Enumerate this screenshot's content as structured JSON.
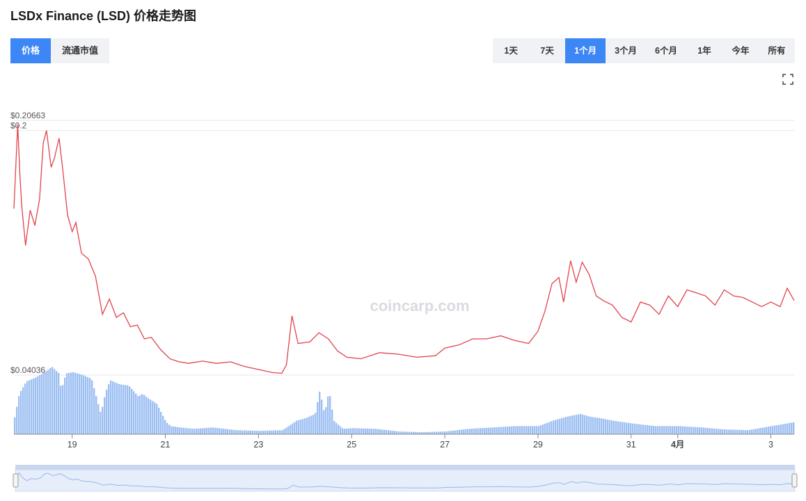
{
  "header": {
    "title": "LSDx Finance (LSD) 价格走势图"
  },
  "metric_tabs": [
    {
      "label": "价格",
      "active": true
    },
    {
      "label": "流通市值",
      "active": false
    }
  ],
  "ranges": [
    {
      "label": "1天",
      "active": false
    },
    {
      "label": "7天",
      "active": false
    },
    {
      "label": "1个月",
      "active": true
    },
    {
      "label": "3个月",
      "active": false
    },
    {
      "label": "6个月",
      "active": false
    },
    {
      "label": "1年",
      "active": false
    },
    {
      "label": "今年",
      "active": false
    },
    {
      "label": "所有",
      "active": false
    }
  ],
  "watermark": "coincarp.com",
  "colors": {
    "line": "#e0424b",
    "volume": "#9dbff2",
    "accent": "#3d86f5",
    "navigator_fill": "#dde8fb"
  },
  "chart_data": {
    "type": "line",
    "title": "",
    "xlabel": "",
    "ylabel": "",
    "y_labels": [
      "$0.20663",
      "$0.2",
      "$0.04036"
    ],
    "ylim": [
      0.04036,
      0.20663
    ],
    "x_ticks": [
      {
        "label": "19",
        "day": 19
      },
      {
        "label": "21",
        "day": 21
      },
      {
        "label": "23",
        "day": 23
      },
      {
        "label": "25",
        "day": 25
      },
      {
        "label": "27",
        "day": 27
      },
      {
        "label": "29",
        "day": 29
      },
      {
        "label": "31",
        "day": 31
      },
      {
        "label": "4月",
        "day": 32
      },
      {
        "label": "3",
        "day": 34
      }
    ],
    "xlim": [
      17.75,
      34.5
    ],
    "price_series": {
      "x": [
        17.75,
        17.83,
        17.88,
        17.92,
        18.0,
        18.1,
        18.2,
        18.3,
        18.38,
        18.45,
        18.55,
        18.62,
        18.72,
        18.8,
        18.9,
        19.0,
        19.08,
        19.2,
        19.35,
        19.5,
        19.65,
        19.8,
        19.95,
        20.1,
        20.25,
        20.4,
        20.55,
        20.7,
        20.9,
        21.1,
        21.3,
        21.5,
        21.8,
        22.1,
        22.4,
        22.7,
        23.0,
        23.3,
        23.5,
        23.6,
        23.72,
        23.85,
        24.1,
        24.3,
        24.5,
        24.7,
        24.9,
        25.2,
        25.6,
        26.0,
        26.4,
        26.8,
        27.0,
        27.3,
        27.6,
        27.9,
        28.2,
        28.5,
        28.8,
        29.0,
        29.15,
        29.3,
        29.45,
        29.55,
        29.7,
        29.82,
        29.95,
        30.1,
        30.25,
        30.4,
        30.6,
        30.8,
        31.0,
        31.2,
        31.4,
        31.6,
        31.8,
        32.0,
        32.2,
        32.4,
        32.6,
        32.8,
        33.0,
        33.2,
        33.4,
        33.6,
        33.8,
        34.0,
        34.2,
        34.35,
        34.5
      ],
      "y": [
        0.149,
        0.204,
        0.17,
        0.15,
        0.125,
        0.148,
        0.138,
        0.155,
        0.192,
        0.2,
        0.176,
        0.182,
        0.195,
        0.174,
        0.145,
        0.134,
        0.14,
        0.12,
        0.116,
        0.105,
        0.08,
        0.09,
        0.078,
        0.081,
        0.072,
        0.073,
        0.064,
        0.065,
        0.057,
        0.051,
        0.049,
        0.048,
        0.0495,
        0.048,
        0.049,
        0.046,
        0.044,
        0.042,
        0.0415,
        0.047,
        0.079,
        0.061,
        0.062,
        0.068,
        0.064,
        0.056,
        0.052,
        0.051,
        0.055,
        0.054,
        0.052,
        0.053,
        0.058,
        0.06,
        0.064,
        0.064,
        0.066,
        0.063,
        0.061,
        0.069,
        0.082,
        0.1,
        0.104,
        0.088,
        0.115,
        0.101,
        0.114,
        0.106,
        0.092,
        0.089,
        0.086,
        0.078,
        0.075,
        0.088,
        0.086,
        0.08,
        0.092,
        0.085,
        0.096,
        0.094,
        0.092,
        0.086,
        0.096,
        0.092,
        0.091,
        0.088,
        0.085,
        0.088,
        0.085,
        0.097,
        0.089
      ]
    },
    "volume_series": {
      "x": [
        17.75,
        17.85,
        18.0,
        18.2,
        18.4,
        18.55,
        18.7,
        18.75,
        18.85,
        19.0,
        19.2,
        19.4,
        19.6,
        19.7,
        19.8,
        20.0,
        20.2,
        20.4,
        20.5,
        20.6,
        20.8,
        21.0,
        21.1,
        21.3,
        21.6,
        22.0,
        22.5,
        23.0,
        23.5,
        23.8,
        24.0,
        24.2,
        24.3,
        24.4,
        24.5,
        24.6,
        24.8,
        25.0,
        25.5,
        26.0,
        26.5,
        27.0,
        27.5,
        28.0,
        28.5,
        29.0,
        29.3,
        29.6,
        29.9,
        30.1,
        30.3,
        30.6,
        31.0,
        31.5,
        32.0,
        32.5,
        33.0,
        33.5,
        34.0,
        34.5
      ],
      "y": [
        0.25,
        0.6,
        0.78,
        0.84,
        0.92,
        1.0,
        0.9,
        0.65,
        0.9,
        0.92,
        0.88,
        0.82,
        0.3,
        0.62,
        0.8,
        0.74,
        0.72,
        0.56,
        0.6,
        0.54,
        0.45,
        0.18,
        0.12,
        0.1,
        0.08,
        0.1,
        0.06,
        0.05,
        0.06,
        0.2,
        0.24,
        0.3,
        0.65,
        0.3,
        0.65,
        0.2,
        0.08,
        0.09,
        0.08,
        0.04,
        0.03,
        0.04,
        0.08,
        0.1,
        0.12,
        0.12,
        0.2,
        0.26,
        0.3,
        0.26,
        0.24,
        0.2,
        0.16,
        0.12,
        0.12,
        0.1,
        0.07,
        0.06,
        0.12,
        0.18
      ]
    }
  }
}
